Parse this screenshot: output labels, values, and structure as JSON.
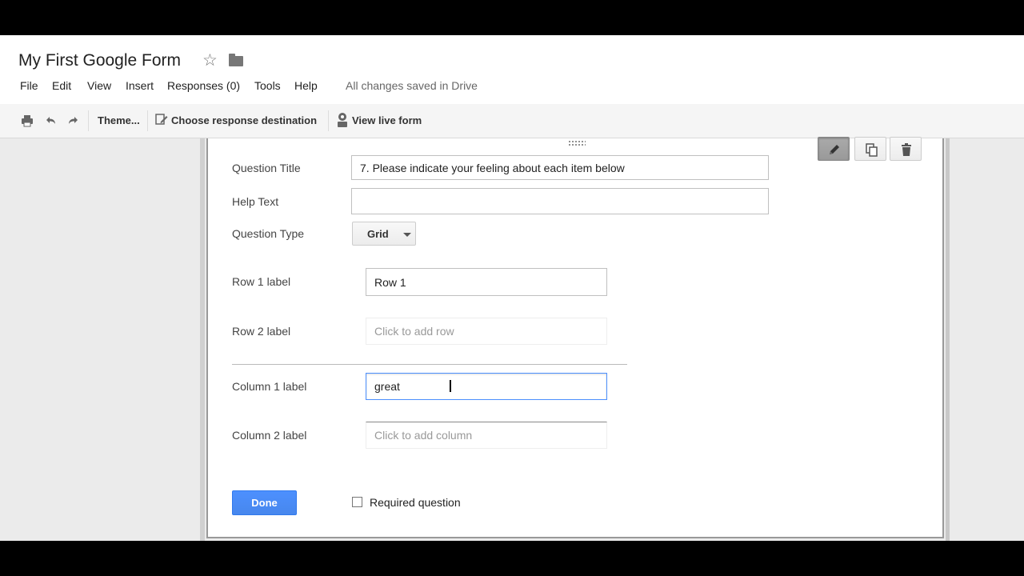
{
  "app": {
    "doc_title": "My First Google Form",
    "saved_status": "All changes saved in Drive"
  },
  "menu": {
    "file": "File",
    "edit": "Edit",
    "view": "View",
    "insert": "Insert",
    "responses": "Responses (0)",
    "tools": "Tools",
    "help": "Help"
  },
  "toolbar": {
    "theme": "Theme...",
    "response_destination": "Choose response destination",
    "view_live": "View live form"
  },
  "question": {
    "title_label": "Question Title",
    "title_value": "7. Please indicate your feeling about each item below",
    "help_label": "Help Text",
    "help_value": "",
    "type_label": "Question Type",
    "type_value": "Grid",
    "rows": [
      {
        "label": "Row 1 label",
        "value": "Row 1",
        "placeholder": ""
      },
      {
        "label": "Row 2 label",
        "value": "",
        "placeholder": "Click to add row"
      }
    ],
    "columns": [
      {
        "label": "Column 1 label",
        "value": "great",
        "placeholder": ""
      },
      {
        "label": "Column 2 label",
        "value": "",
        "placeholder": "Click to add column"
      }
    ],
    "done_label": "Done",
    "required_label": "Required question",
    "required_checked": false
  },
  "colors": {
    "accent_blue": "#4d90fe",
    "toolbar_bg": "#f5f5f5",
    "canvas_bg": "#ebebeb"
  },
  "icons": [
    "star-icon",
    "folder-icon",
    "print-icon",
    "undo-icon",
    "redo-icon",
    "edit-form-icon",
    "live-form-icon",
    "pencil-icon",
    "duplicate-icon",
    "trash-icon",
    "drag-handle-icon",
    "text-cursor-icon"
  ]
}
